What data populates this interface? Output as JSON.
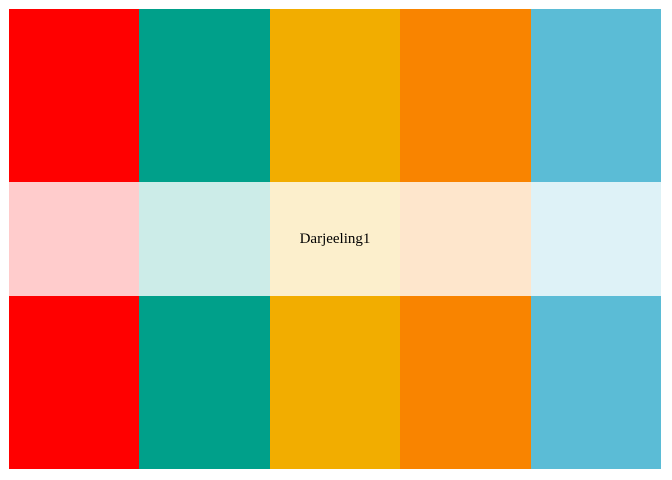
{
  "palette": {
    "name": "Darjeeling1",
    "colors": [
      "#FF0000",
      "#00A08A",
      "#F2AD00",
      "#F98400",
      "#5BBCD6"
    ],
    "tints": [
      "#FFCCCC",
      "#CCECE8",
      "#FCEFCC",
      "#FEE6CC",
      "#DEF2F7"
    ]
  }
}
